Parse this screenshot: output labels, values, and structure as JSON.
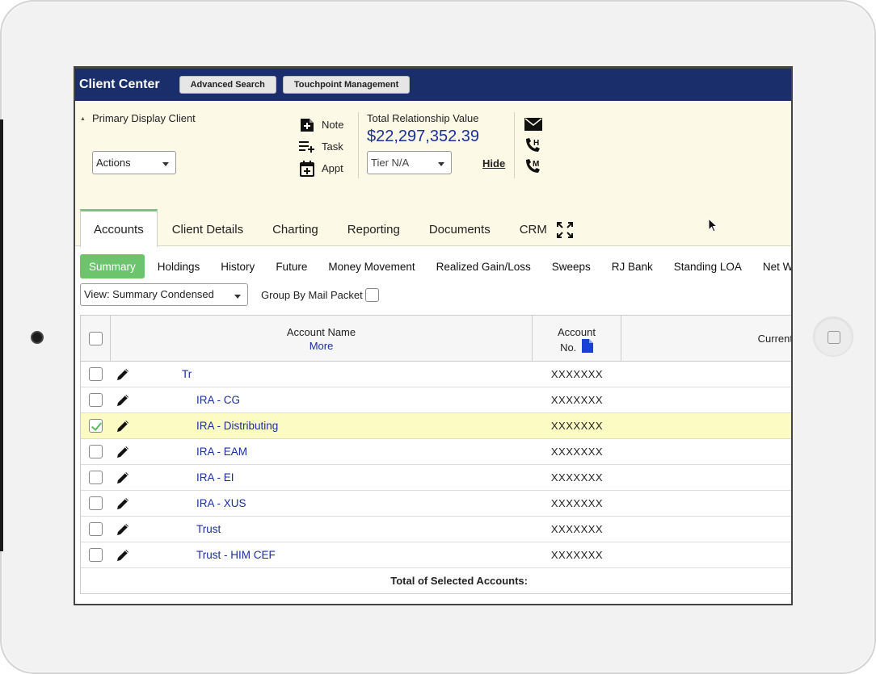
{
  "header": {
    "title": "Client Center",
    "buttons": [
      "Advanced Search",
      "Touchpoint Management"
    ]
  },
  "client_panel": {
    "primary_display_client_label": "Primary Display Client",
    "actions_select": "Actions",
    "quick_actions": [
      "Note",
      "Task",
      "Appt"
    ],
    "total_relationship_value_label": "Total Relationship Value",
    "total_relationship_value": "$22,297,352.39",
    "tier_select": "Tier N/A",
    "hide_link": "Hide",
    "contact_icons": [
      "envelope-icon",
      "phone-home-icon",
      "phone-mobile-icon"
    ]
  },
  "tabs": [
    {
      "label": "Accounts",
      "active": true
    },
    {
      "label": "Client Details"
    },
    {
      "label": "Charting"
    },
    {
      "label": "Reporting"
    },
    {
      "label": "Documents"
    },
    {
      "label": "CRM"
    }
  ],
  "subnav": [
    {
      "label": "Summary",
      "active": true
    },
    {
      "label": "Holdings"
    },
    {
      "label": "History"
    },
    {
      "label": "Future"
    },
    {
      "label": "Money Movement"
    },
    {
      "label": "Realized Gain/Loss"
    },
    {
      "label": "Sweeps"
    },
    {
      "label": "RJ Bank"
    },
    {
      "label": "Standing LOA"
    },
    {
      "label": "Net Wo"
    }
  ],
  "toolbar": {
    "view_select": "View: Summary Condensed",
    "group_by_label": "Group By Mail Packet"
  },
  "table": {
    "col_account_name": "Account Name",
    "col_more": "More",
    "col_account_no_1": "Account",
    "col_account_no_2": "No.",
    "col_current": "Current",
    "rows": [
      {
        "name": "Tr",
        "acct": "XXXXXXX",
        "checked": false,
        "level": 0
      },
      {
        "name": "IRA - CG",
        "acct": "XXXXXXX",
        "checked": false,
        "level": 1
      },
      {
        "name": "IRA - Distributing",
        "acct": "XXXXXXX",
        "checked": true,
        "level": 1
      },
      {
        "name": "IRA - EAM",
        "acct": "XXXXXXX",
        "checked": false,
        "level": 1
      },
      {
        "name": "IRA - EI",
        "acct": "XXXXXXX",
        "checked": false,
        "level": 1
      },
      {
        "name": "IRA - XUS",
        "acct": "XXXXXXX",
        "checked": false,
        "level": 1
      },
      {
        "name": "Trust",
        "acct": "XXXXXXX",
        "checked": false,
        "level": 1
      },
      {
        "name": "Trust - HIM CEF",
        "acct": "XXXXXXX",
        "checked": false,
        "level": 1
      }
    ],
    "total_label": "Total of Selected Accounts:"
  },
  "colors": {
    "header_bg": "#1a2e6b",
    "panel_bg": "#fcf9e6",
    "accent_green": "#6cc56c",
    "link_blue": "#1a2ea0",
    "selected_row": "#fdfbc4"
  }
}
